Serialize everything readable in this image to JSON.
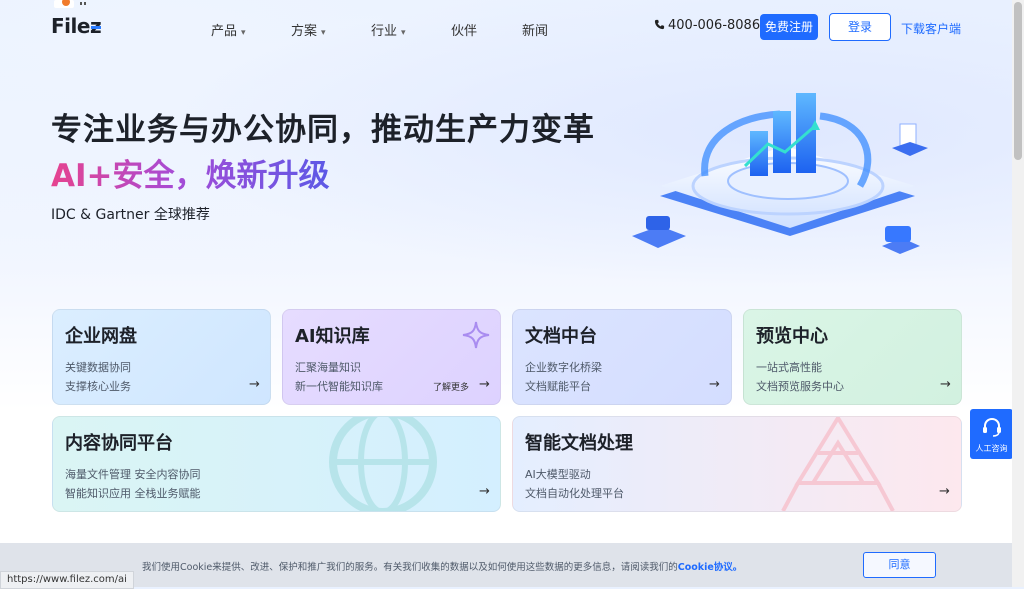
{
  "header": {
    "logo": "Filez",
    "nav": [
      {
        "label": "产品",
        "dropdown": true
      },
      {
        "label": "方案",
        "dropdown": true
      },
      {
        "label": "行业",
        "dropdown": true
      },
      {
        "label": "伙伴",
        "dropdown": false
      },
      {
        "label": "新闻",
        "dropdown": false
      }
    ],
    "phone": "400-006-8086",
    "register": "免费注册",
    "login": "登录",
    "download": "下载客户端"
  },
  "hero": {
    "title": "专注业务与办公协同，推动生产力变革",
    "subtitle": "AI+安全，焕新升级",
    "tagline": "IDC & Gartner 全球推荐"
  },
  "cards": [
    {
      "title": "企业网盘",
      "line1": "关键数据协同",
      "line2": "支撑核心业务",
      "arrow": "→"
    },
    {
      "title": "AI知识库",
      "line1": "汇聚海量知识",
      "line2": "新一代智能知识库",
      "more": "了解更多",
      "arrow": "→"
    },
    {
      "title": "文档中台",
      "line1": "企业数字化桥梁",
      "line2": "文档赋能平台",
      "arrow": "→"
    },
    {
      "title": "预览中心",
      "line1": "一站式高性能",
      "line2": "文档预览服务中心",
      "arrow": "→"
    },
    {
      "title": "内容协同平台",
      "line1": "海量文件管理 安全内容协同",
      "line2": "智能知识应用 全栈业务赋能",
      "arrow": "→"
    },
    {
      "title": "智能文档处理",
      "line1": "AI大模型驱动",
      "line2": "文档自动化处理平台",
      "arrow": "→"
    }
  ],
  "consult": {
    "label": "人工咨询",
    "icon": "headset-icon"
  },
  "cookie": {
    "text": "我们使用Cookie来提供、改进、保护和推广我们的服务。有关我们收集的数据以及如何使用这些数据的更多信息，请阅读我们的",
    "link": "Cookie协议。",
    "button": "同意"
  },
  "status_url": "https://www.filez.com/ai",
  "colors": {
    "accent": "#1f6bff",
    "gradient_start": "#e6438f",
    "gradient_end": "#5c59e6"
  }
}
